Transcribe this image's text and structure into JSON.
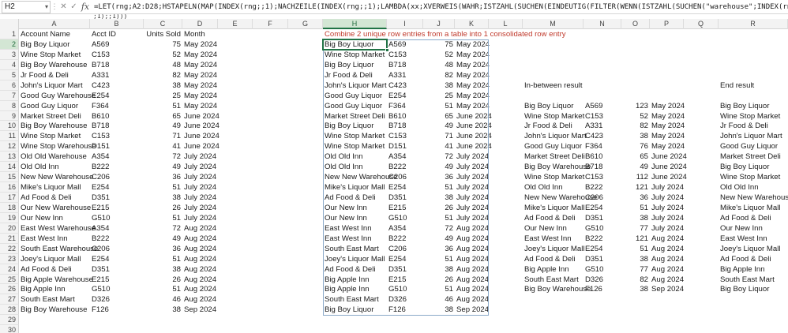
{
  "name_box": "H2",
  "formula": "=LET(rng;A2:D28;HSTAPELN(MAP(INDEX(rng;;1);NACHZEILE(INDEX(rng;;1);LAMBDA(xx;XVERWEIS(WAHR;ISTZAHL(SUCHEN(EINDEUTIG(FILTER(WENN(ISTZAHL(SUCHEN(\"warehouse\";INDEX(rng;;1)));TEXTVOR(INDEX(rng;;1);",
  "formula_overflow": ";1);;1)))",
  "columns": [
    "A",
    "B",
    "C",
    "D",
    "E",
    "F",
    "G",
    "H",
    "I",
    "J",
    "K",
    "L",
    "M",
    "N",
    "O",
    "P",
    "Q",
    "R"
  ],
  "row_numbers": [
    "1",
    "2",
    "3",
    "4",
    "5",
    "6",
    "7",
    "8",
    "9",
    "10",
    "11",
    "12",
    "13",
    "14",
    "15",
    "16",
    "17",
    "18",
    "19",
    "20",
    "21",
    "22",
    "23",
    "24",
    "25",
    "26",
    "27",
    "28",
    "29",
    "30"
  ],
  "headers": {
    "account": "Account Name",
    "acct_id": "Acct ID",
    "units": "Units Sold",
    "month": "Month"
  },
  "title": "Combine 2 unique row entries from a table into 1 consolidated row entry",
  "labels": {
    "in_between": "In-between result",
    "end": "End result"
  },
  "source_rows": [
    [
      "Big Boy Liquor",
      "A569",
      "75",
      "May 2024"
    ],
    [
      "Wine Stop Market",
      "C153",
      "52",
      "May 2024"
    ],
    [
      "Big Boy Warehouse",
      "B718",
      "48",
      "May 2024"
    ],
    [
      "Jr Food & Deli",
      "A331",
      "82",
      "May 2024"
    ],
    [
      "John's Liquor Mart",
      "C423",
      "38",
      "May 2024"
    ],
    [
      "Good Guy Warehouse",
      "E254",
      "25",
      "May 2024"
    ],
    [
      "Good Guy Liquor",
      "F364",
      "51",
      "May 2024"
    ],
    [
      "Market Street Deli",
      "B610",
      "65",
      "June 2024"
    ],
    [
      "Big Boy Warehouse",
      "B718",
      "49",
      "June 2024"
    ],
    [
      "Wine Stop Market",
      "C153",
      "71",
      "June 2024"
    ],
    [
      "Wine Stop Warehouse",
      "D151",
      "41",
      "June 2024"
    ],
    [
      "Old Old Warehouse",
      "A354",
      "72",
      "July 2024"
    ],
    [
      "Old Old Inn",
      "B222",
      "49",
      "July 2024"
    ],
    [
      "New New Warehouse",
      "C206",
      "36",
      "July 2024"
    ],
    [
      "Mike's Liquor Mall",
      "E254",
      "51",
      "July 2024"
    ],
    [
      "Ad Food & Deli",
      "D351",
      "38",
      "July 2024"
    ],
    [
      "Our New Warehouse",
      "E215",
      "26",
      "July 2024"
    ],
    [
      "Our New Inn",
      "G510",
      "51",
      "July 2024"
    ],
    [
      "East West Warehouse",
      "A354",
      "72",
      "Aug 2024"
    ],
    [
      "East West Inn",
      "B222",
      "49",
      "Aug 2024"
    ],
    [
      "South East Warehouse",
      "C206",
      "36",
      "Aug 2024"
    ],
    [
      "Joey's Liquor Mall",
      "E254",
      "51",
      "Aug 2024"
    ],
    [
      "Ad Food & Deli",
      "D351",
      "38",
      "Aug 2024"
    ],
    [
      "Big Apple Warehouse",
      "E215",
      "26",
      "Aug 2024"
    ],
    [
      "Big Apple Inn",
      "G510",
      "51",
      "Aug 2024"
    ],
    [
      "South East Mart",
      "D326",
      "46",
      "Aug 2024"
    ],
    [
      "Big Boy Warehouse",
      "F126",
      "38",
      "Sep 2024"
    ]
  ],
  "mapped_rows": [
    [
      "Big Boy Liquor",
      "A569",
      "75",
      "May 2024"
    ],
    [
      "Wine Stop Market",
      "C153",
      "52",
      "May 2024"
    ],
    [
      "Big Boy Liquor",
      "B718",
      "48",
      "May 2024"
    ],
    [
      "Jr Food & Deli",
      "A331",
      "82",
      "May 2024"
    ],
    [
      "John's Liquor Mart",
      "C423",
      "38",
      "May 2024"
    ],
    [
      "Good Guy Liquor",
      "E254",
      "25",
      "May 2024"
    ],
    [
      "Good Guy Liquor",
      "F364",
      "51",
      "May 2024"
    ],
    [
      "Market Street Deli",
      "B610",
      "65",
      "June 2024"
    ],
    [
      "Big Boy Liquor",
      "B718",
      "49",
      "June 2024"
    ],
    [
      "Wine Stop Market",
      "C153",
      "71",
      "June 2024"
    ],
    [
      "Wine Stop Market",
      "D151",
      "41",
      "June 2024"
    ],
    [
      "Old Old Inn",
      "A354",
      "72",
      "July 2024"
    ],
    [
      "Old Old Inn",
      "B222",
      "49",
      "July 2024"
    ],
    [
      "New New Warehouse",
      "C206",
      "36",
      "July 2024"
    ],
    [
      "Mike's Liquor Mall",
      "E254",
      "51",
      "July 2024"
    ],
    [
      "Ad Food & Deli",
      "D351",
      "38",
      "July 2024"
    ],
    [
      "Our New Inn",
      "E215",
      "26",
      "July 2024"
    ],
    [
      "Our New Inn",
      "G510",
      "51",
      "July 2024"
    ],
    [
      "East West Inn",
      "A354",
      "72",
      "Aug 2024"
    ],
    [
      "East West Inn",
      "B222",
      "49",
      "Aug 2024"
    ],
    [
      "South East Mart",
      "C206",
      "36",
      "Aug 2024"
    ],
    [
      "Joey's Liquor Mall",
      "E254",
      "51",
      "Aug 2024"
    ],
    [
      "Ad Food & Deli",
      "D351",
      "38",
      "Aug 2024"
    ],
    [
      "Big Apple Inn",
      "E215",
      "26",
      "Aug 2024"
    ],
    [
      "Big Apple Inn",
      "G510",
      "51",
      "Aug 2024"
    ],
    [
      "South East Mart",
      "D326",
      "46",
      "Aug 2024"
    ],
    [
      "Big Boy Liquor",
      "F126",
      "38",
      "Sep 2024"
    ]
  ],
  "in_between_rows": [
    [
      "Big Boy Liquor",
      "A569",
      "123",
      "May 2024"
    ],
    [
      "Wine Stop Market",
      "C153",
      "52",
      "May 2024"
    ],
    [
      "Jr Food & Deli",
      "A331",
      "82",
      "May 2024"
    ],
    [
      "John's Liquor Mart",
      "C423",
      "38",
      "May 2024"
    ],
    [
      "Good Guy Liquor",
      "F364",
      "76",
      "May 2024"
    ],
    [
      "Market Street Deli",
      "B610",
      "65",
      "June 2024"
    ],
    [
      "Big Boy Warehouse",
      "B718",
      "49",
      "June 2024"
    ],
    [
      "Wine Stop Market",
      "C153",
      "112",
      "June 2024"
    ],
    [
      "Old Old Inn",
      "B222",
      "121",
      "July 2024"
    ],
    [
      "New New Warehouse",
      "C206",
      "36",
      "July 2024"
    ],
    [
      "Mike's Liquor Mall",
      "E254",
      "51",
      "July 2024"
    ],
    [
      "Ad Food & Deli",
      "D351",
      "38",
      "July 2024"
    ],
    [
      "Our New Inn",
      "G510",
      "77",
      "July 2024"
    ],
    [
      "East West Inn",
      "B222",
      "121",
      "Aug 2024"
    ],
    [
      "Joey's Liquor Mall",
      "E254",
      "51",
      "Aug 2024"
    ],
    [
      "Ad Food & Deli",
      "D351",
      "38",
      "Aug 2024"
    ],
    [
      "Big Apple Inn",
      "G510",
      "77",
      "Aug 2024"
    ],
    [
      "South East Mart",
      "D326",
      "82",
      "Aug 2024"
    ],
    [
      "Big Boy Warehouse",
      "F126",
      "38",
      "Sep 2024"
    ]
  ],
  "end_rows": [
    "Big Boy Liquor",
    "Wine Stop Market",
    "Jr Food & Deli",
    "John's Liquor Mart",
    "Good Guy Liquor",
    "Market Street Deli",
    "Big Boy Liquor",
    "Wine Stop Market",
    "Old Old Inn",
    "New New Warehouse",
    "Mike's Liquor Mall",
    "Ad Food & Deli",
    "Our New Inn",
    "East West Inn",
    "Joey's Liquor Mall",
    "Ad Food & Deli",
    "Big Apple Inn",
    "South East Mart",
    "Big Boy Liquor"
  ]
}
